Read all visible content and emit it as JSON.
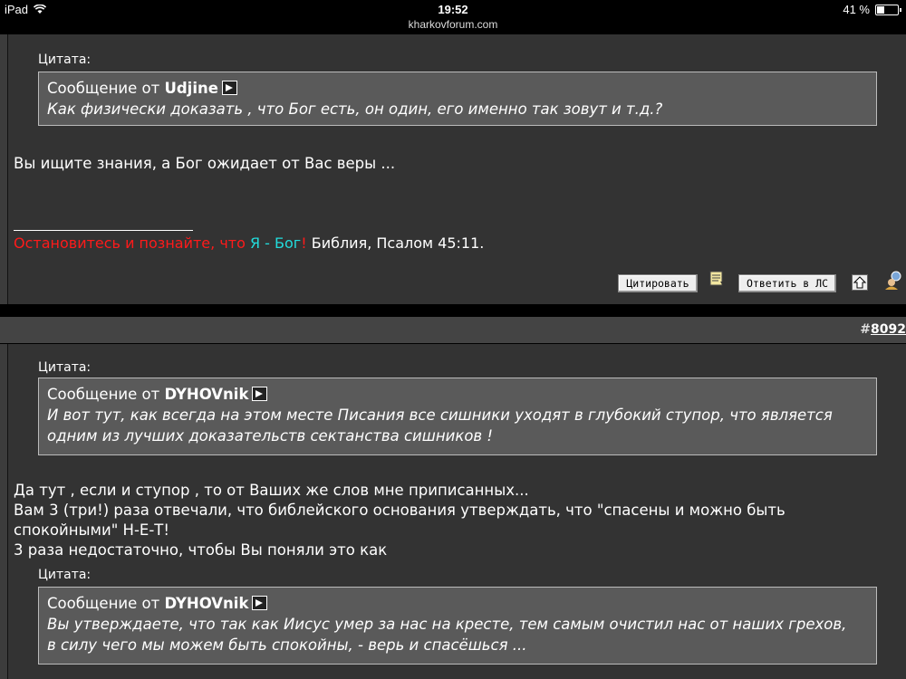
{
  "status_bar": {
    "device": "iPad",
    "time": "19:52",
    "url": "kharkovforum.com",
    "battery_text": "41 %",
    "battery_level": 0.41
  },
  "post1": {
    "quote_label": "Цитата:",
    "quote_prefix": "Сообщение от ",
    "quote_author": "Udjine",
    "quote_text": "Как физически доказать , что Бог есть, он один, его именно так зовут и т.д.?",
    "body": "Вы ищите знания, а Бог ожидает от Вас веры ...",
    "signature": {
      "part1": "Остановитесь и познайте, что ",
      "part2": "Я - Бог",
      "part3": "!",
      "part4": " Библия, Псалом 45:11."
    },
    "buttons": {
      "quote": "Цитировать",
      "reply_pm": "Ответить в ЛС"
    }
  },
  "post2": {
    "hash": "#",
    "number": "8092",
    "quote1": {
      "label": "Цитата:",
      "prefix": "Сообщение от ",
      "author": "DYHOVnik",
      "line1": "И вот тут, как всегда на этом месте Писания все сишники уходят в глубокий ступор, что является",
      "line2": "одним из лучших доказательств сектанства сишников !"
    },
    "body_lines": [
      "Да тут , если и ступор , то от Ваших же слов мне приписанных...",
      "Вам 3 (три!) раза отвечали, что библейского основания утверждать, что \"спасены и можно быть",
      "спокойными\" Н-Е-Т!",
      "3 раза недостаточно, чтобы Вы поняли это как"
    ],
    "quote2": {
      "label": "Цитата:",
      "prefix": "Сообщение от ",
      "author": "DYHOVnik",
      "line1": "Вы утверждаете, что так как Иисус умер за нас на кресте, тем самым очистил нас от наших грехов,",
      "line2": "в силу чего мы можем быть спокойны, - верь и спасёшься ..."
    }
  },
  "icons": [
    "wifi-icon",
    "battery-icon",
    "goto-post-icon",
    "multiquote-icon",
    "top-icon",
    "user-icon"
  ],
  "colors": {
    "signature_red": "#ff1a1a",
    "signature_cyan": "#22dddd",
    "background": "#333333",
    "quote_bg": "#5a5a5a"
  }
}
